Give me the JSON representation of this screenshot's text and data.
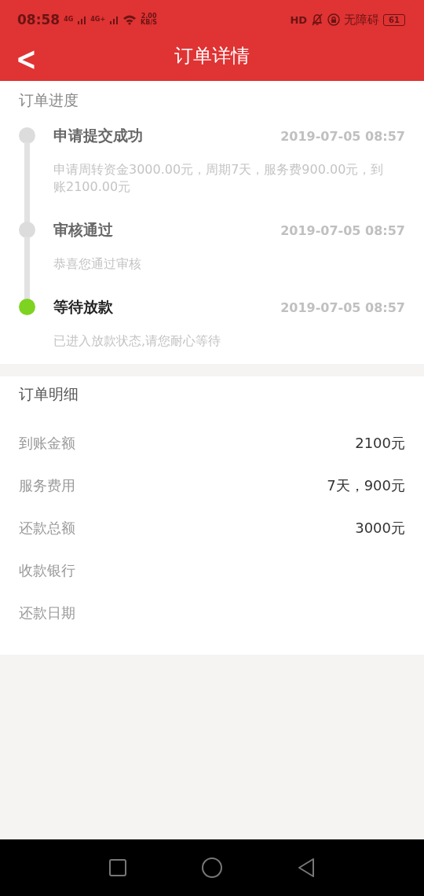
{
  "status_bar": {
    "time": "08:58",
    "network_1": "4G",
    "network_2": "4G+",
    "speed": "2.00",
    "speed_unit": "KB/S",
    "hd": "HD",
    "accessibility": "无障碍",
    "battery": "61"
  },
  "header": {
    "back": "<",
    "title": "订单详情"
  },
  "progress": {
    "title": "订单进度",
    "steps": [
      {
        "title": "申请提交成功",
        "time": "2019-07-05 08:57",
        "description": "申请周转资金3000.00元，周期7天，服务费900.00元，到账2100.00元",
        "active": false
      },
      {
        "title": "审核通过",
        "time": "2019-07-05 08:57",
        "description": "恭喜您通过审核",
        "active": false
      },
      {
        "title": "等待放款",
        "time": "2019-07-05 08:57",
        "description": "已进入放款状态,请您耐心等待",
        "active": true
      }
    ]
  },
  "details": {
    "title": "订单明细",
    "rows": [
      {
        "label": "到账金额",
        "value": "2100元"
      },
      {
        "label": "服务费用",
        "value": "7天，900元"
      },
      {
        "label": "还款总额",
        "value": "3000元"
      },
      {
        "label": "收款银行"
      },
      {
        "label": "还款日期"
      }
    ]
  }
}
